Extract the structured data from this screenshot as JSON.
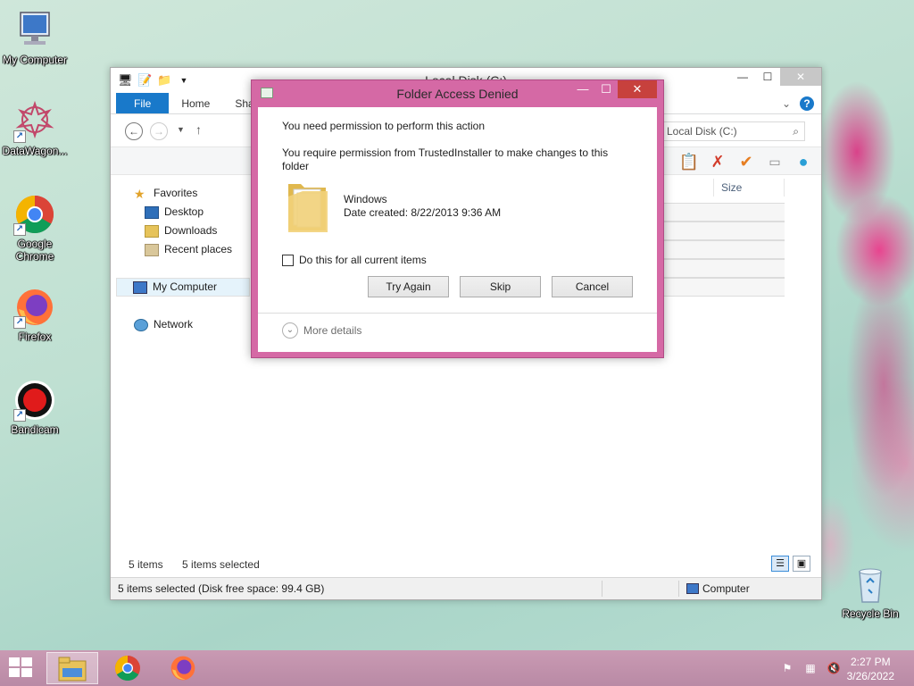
{
  "desktop": {
    "icons": [
      {
        "label": "My Computer"
      },
      {
        "label": "DataWagon..."
      },
      {
        "label": "Google Chrome"
      },
      {
        "label": "Firefox"
      },
      {
        "label": "Bandicam"
      },
      {
        "label": "Recycle Bin"
      }
    ]
  },
  "explorer": {
    "title": "Local Disk (C:)",
    "tabs": [
      "File",
      "Home",
      "Shar"
    ],
    "search_placeholder": "Local Disk (C:)",
    "column_size": "Size",
    "nav": {
      "favorites": "Favorites",
      "desktop": "Desktop",
      "downloads": "Downloads",
      "recent": "Recent places",
      "my_computer": "My Computer",
      "network": "Network"
    },
    "status_items": "5 items",
    "status_selected": "5 items selected",
    "statusbar_left": "5 items selected (Disk free space: 99.4 GB)",
    "statusbar_right": "Computer"
  },
  "dialog": {
    "title": "Folder Access Denied",
    "line1": "You need permission to perform this action",
    "line2": "You require permission from TrustedInstaller to make changes to this folder",
    "folder_name": "Windows",
    "date_created": "Date created: 8/22/2013 9:36 AM",
    "checkbox_label": "Do this for all current items",
    "try_again": "Try Again",
    "skip": "Skip",
    "cancel": "Cancel",
    "more_details": "More details"
  },
  "taskbar": {
    "time": "2:27 PM",
    "date": "3/26/2022"
  },
  "colors": {
    "dialog_frame": "#d569a5",
    "ribbon_file": "#1979ca",
    "close_button": "#c7413d"
  }
}
